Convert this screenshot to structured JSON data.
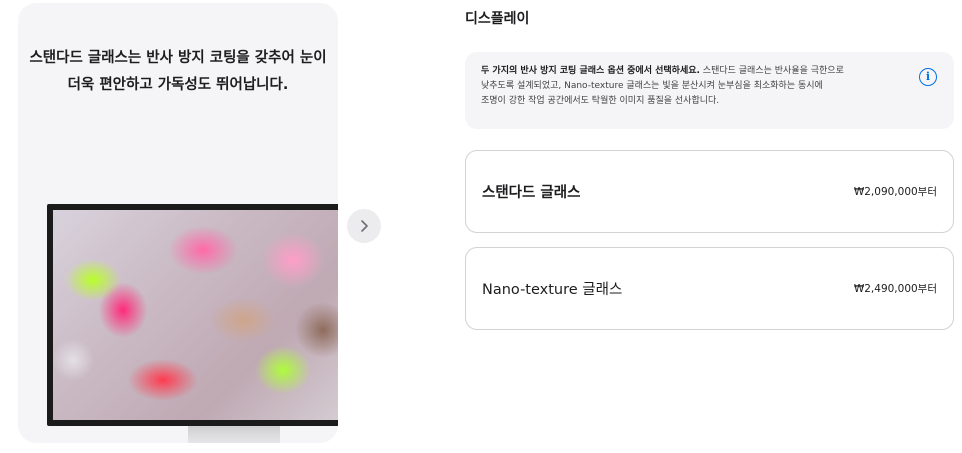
{
  "gallery": {
    "caption_line1": "스탠다드 글래스는 반사 방지 코팅을 갖추어 눈이",
    "caption_line2": "더욱 편안하고 가독성도 뛰어납니다.",
    "next_icon": "chevron-right-icon"
  },
  "display": {
    "title": "디스플레이",
    "info": {
      "bold_text": "두 가지의 반사 방지 코팅 글래스 옵션 중에서 선택하세요.",
      "text_line1": " 스탠다드 글래스는 반사율을 극한으로",
      "text_line2": "낮추도록 설계되었고, Nano-texture 글래스는 빛을 분산시켜 눈부심을 최소화하는 동시에",
      "text_line3": "조명이 강한 작업 공간에서도 탁월한 이미지 품질을 선사합니다.",
      "icon": "info-icon",
      "accent_color": "#0071e3"
    },
    "options": [
      {
        "name": "스탠다드 글래스",
        "price": "₩2,090,000부터"
      },
      {
        "name": "Nano-texture 글래스",
        "price": "₩2,490,000부터"
      }
    ]
  }
}
